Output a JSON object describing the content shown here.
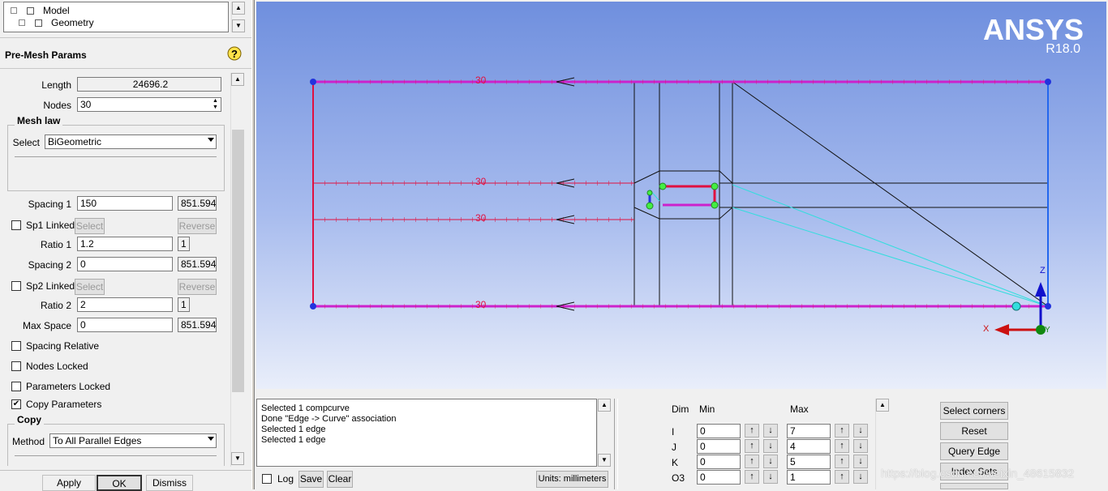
{
  "tree": {
    "items": [
      {
        "label": "Model"
      },
      {
        "label": "Geometry"
      }
    ]
  },
  "panel": {
    "title": "Pre-Mesh Params",
    "length_label": "Length",
    "length_value": "24696.2",
    "nodes_label": "Nodes",
    "nodes_value": "30",
    "mesh_law_title": "Mesh law",
    "select_label": "Select",
    "select_value": "BiGeometric",
    "spacing1_label": "Spacing 1",
    "spacing1_value": "150",
    "spacing1_max": "851.594",
    "sp1_linked_label": "Sp1 Linked",
    "sp2_linked_label": "Sp2 Linked",
    "select_btn": "Select",
    "reverse_btn": "Reverse",
    "ratio1_label": "Ratio 1",
    "ratio1_value": "1.2",
    "ratio1_max": "1",
    "spacing2_label": "Spacing 2",
    "spacing2_value": "0",
    "spacing2_max": "851.594",
    "ratio2_label": "Ratio 2",
    "ratio2_value": "2",
    "ratio2_max": "1",
    "maxspace_label": "Max Space",
    "maxspace_value": "0",
    "maxspace_max": "851.594",
    "spacing_relative_label": "Spacing Relative",
    "nodes_locked_label": "Nodes Locked",
    "params_locked_label": "Parameters Locked",
    "copy_params_label": "Copy Parameters",
    "copy_title": "Copy",
    "method_label": "Method",
    "method_value": "To All Parallel Edges",
    "apply_btn": "Apply",
    "ok_btn": "OK",
    "dismiss_btn": "Dismiss"
  },
  "viewport": {
    "brand": "ANSYS",
    "version": "R18.0",
    "edge_labels": [
      "30",
      "30",
      "30",
      "30"
    ],
    "axis": {
      "z": "Z",
      "x": "X",
      "y": "Y"
    }
  },
  "messages": {
    "lines": [
      {
        "text": "Selected 1 compcurve"
      },
      {
        "text": "Done \"Edge -> Curve\" association"
      },
      {
        "text": "Selected 1 edge"
      },
      {
        "text": "Selected 1 edge"
      }
    ],
    "log_label": "Log",
    "save_btn": "Save",
    "clear_btn": "Clear",
    "units_btn": "Units: millimeters"
  },
  "dims": {
    "col_dim": "Dim",
    "col_min": "Min",
    "col_max": "Max",
    "rows": [
      {
        "name": "I",
        "min": "0",
        "max": "7"
      },
      {
        "name": "J",
        "min": "0",
        "max": "4"
      },
      {
        "name": "K",
        "min": "0",
        "max": "5"
      },
      {
        "name": "O3",
        "min": "0",
        "max": "1"
      }
    ]
  },
  "actions": {
    "select_corners": "Select corners",
    "reset": "Reset",
    "query_edge": "Query Edge",
    "index_sets": "Index Sets"
  },
  "watermark": "https://blog.csdn.net/weixin_48615832",
  "colors": {
    "accent_magenta": "#cc22cc",
    "edge_red": "#e01040",
    "node_blue": "#2233dd",
    "cyan": "#33dddd"
  }
}
